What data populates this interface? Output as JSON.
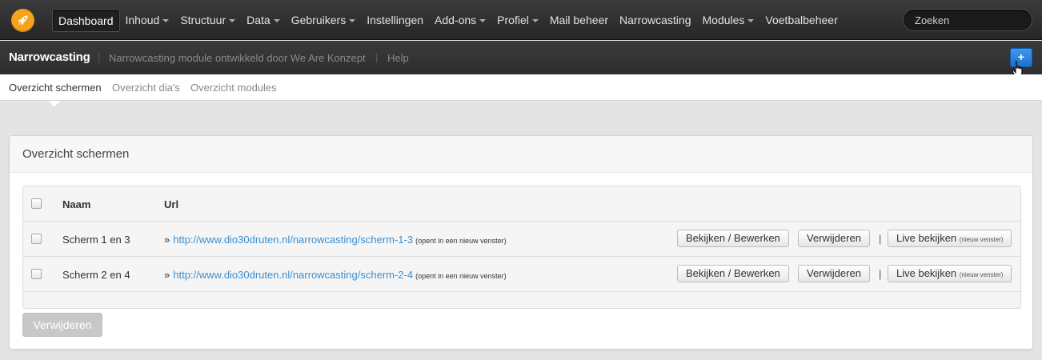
{
  "topnav": {
    "items": [
      {
        "label": "Dashboard",
        "dropdown": false,
        "active": true
      },
      {
        "label": "Inhoud",
        "dropdown": true
      },
      {
        "label": "Structuur",
        "dropdown": true
      },
      {
        "label": "Data",
        "dropdown": true
      },
      {
        "label": "Gebruikers",
        "dropdown": true
      },
      {
        "label": "Instellingen",
        "dropdown": false
      },
      {
        "label": "Add-ons",
        "dropdown": true
      },
      {
        "label": "Profiel",
        "dropdown": true
      },
      {
        "label": "Mail beheer",
        "dropdown": false
      },
      {
        "label": "Narrowcasting",
        "dropdown": false
      },
      {
        "label": "Modules",
        "dropdown": true
      },
      {
        "label": "Voetbalbeheer",
        "dropdown": false
      }
    ],
    "search_placeholder": "Zoeken",
    "logo_icon": "rocket-icon",
    "logo_color": "#f5a31a"
  },
  "subheader": {
    "title": "Narrowcasting",
    "description": "Narrowcasting module ontwikkeld door We Are Konzept",
    "help": "Help",
    "add_label": "+",
    "add_color": "#2b84e0"
  },
  "tabs": [
    {
      "label": "Overzicht schermen",
      "active": true
    },
    {
      "label": "Overzicht dia's",
      "active": false
    },
    {
      "label": "Overzicht modules",
      "active": false
    }
  ],
  "panel": {
    "title": "Overzicht schermen",
    "columns": {
      "name": "Naam",
      "url": "Url"
    },
    "rows": [
      {
        "name": "Scherm 1 en 3",
        "url": "http://www.dio30druten.nl/narrowcasting/scherm-1-3",
        "url_note": "(opent in een nieuw venster)",
        "edit": "Bekijken / Bewerken",
        "delete": "Verwijderen",
        "live": "Live bekijken",
        "live_note": "(nieuw venster)"
      },
      {
        "name": "Scherm 2 en 4",
        "url": "http://www.dio30druten.nl/narrowcasting/scherm-2-4",
        "url_note": "(opent in een nieuw venster)",
        "edit": "Bekijken / Bewerken",
        "delete": "Verwijderen",
        "live": "Live bekijken",
        "live_note": "(nieuw venster)"
      }
    ],
    "bulk_delete": "Verwijderen",
    "link_color": "#3a8fd1"
  }
}
